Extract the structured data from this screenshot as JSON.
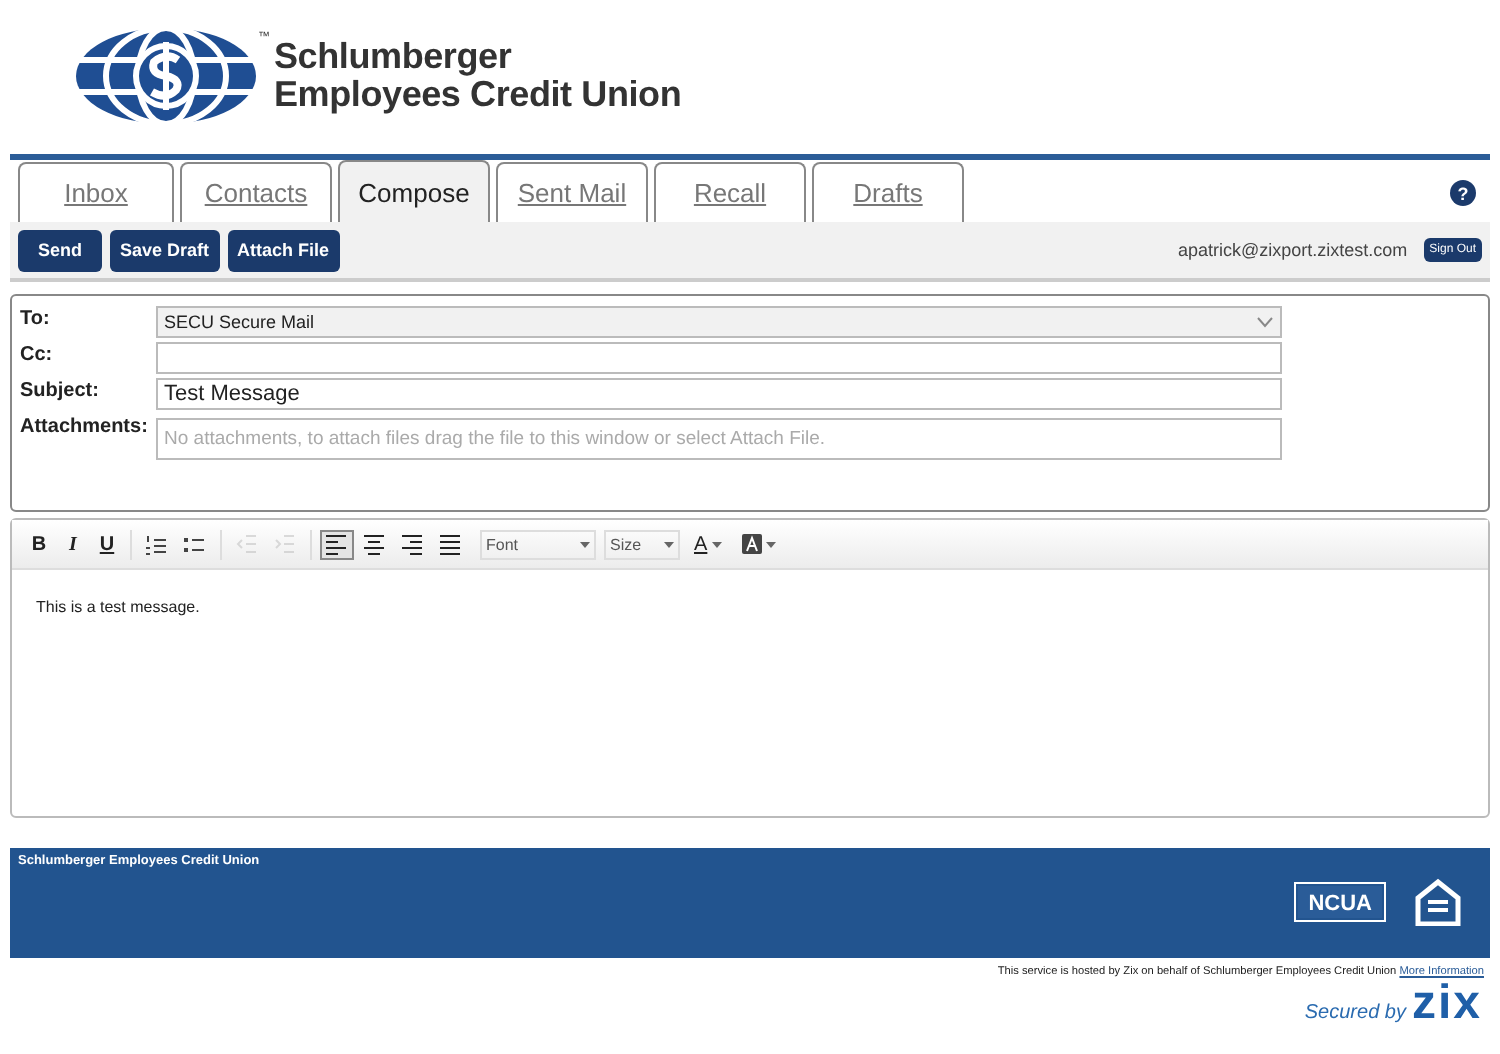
{
  "header": {
    "logo_name_line1": "Schlumberger",
    "logo_name_line2": "Employees Credit Union",
    "logo_tm": "™"
  },
  "tabs": [
    {
      "label": "Inbox",
      "selected": false
    },
    {
      "label": "Contacts",
      "selected": false
    },
    {
      "label": "Compose",
      "selected": true
    },
    {
      "label": "Sent Mail",
      "selected": false
    },
    {
      "label": "Recall",
      "selected": false
    },
    {
      "label": "Drafts",
      "selected": false
    }
  ],
  "help": "?",
  "toolbar": {
    "buttons": [
      "Send",
      "Save Draft",
      "Attach File"
    ],
    "user": "apatrick@zixport.zixtest.com",
    "sign_out": "Sign Out"
  },
  "form": [
    {
      "kind": "select",
      "label": "To:",
      "value": "SECU Secure Mail"
    },
    {
      "kind": "input",
      "label": "Cc:"
    },
    {
      "kind": "input",
      "label": "Subject:",
      "value": "Test Message"
    },
    {
      "kind": "attach",
      "label": "Attachments:",
      "placeholder": "No attachments, to attach files drag the file to this window or select Attach File."
    }
  ],
  "editor": {
    "tools": [
      {
        "kind": "text",
        "label": "B"
      },
      {
        "kind": "text",
        "label": "I"
      },
      {
        "kind": "text",
        "label": "U"
      },
      {
        "kind": "sep"
      },
      {
        "kind": "icon"
      },
      {
        "kind": "icon"
      },
      {
        "kind": "sep"
      },
      {
        "kind": "icon",
        "disabled": true
      },
      {
        "kind": "icon",
        "disabled": true
      },
      {
        "kind": "sep"
      },
      {
        "kind": "icon",
        "selected": true
      },
      {
        "kind": "icon",
        "selected": false
      },
      {
        "kind": "icon",
        "selected": false
      },
      {
        "kind": "icon",
        "selected": false
      },
      {
        "kind": "dropdown",
        "label": "Font"
      },
      {
        "kind": "dropdown",
        "label": "Size"
      },
      {
        "kind": "color",
        "label": "A"
      },
      {
        "kind": "bgcolor"
      }
    ],
    "body": "This is a test message."
  },
  "footer": {
    "org": "Schlumberger Employees Credit Union",
    "ncua": "NCUA",
    "note": "This service is hosted by Zix on behalf of Schlumberger Employees Credit Union",
    "link": "More Information",
    "secured_by": "Secured by",
    "brand": "zix"
  }
}
